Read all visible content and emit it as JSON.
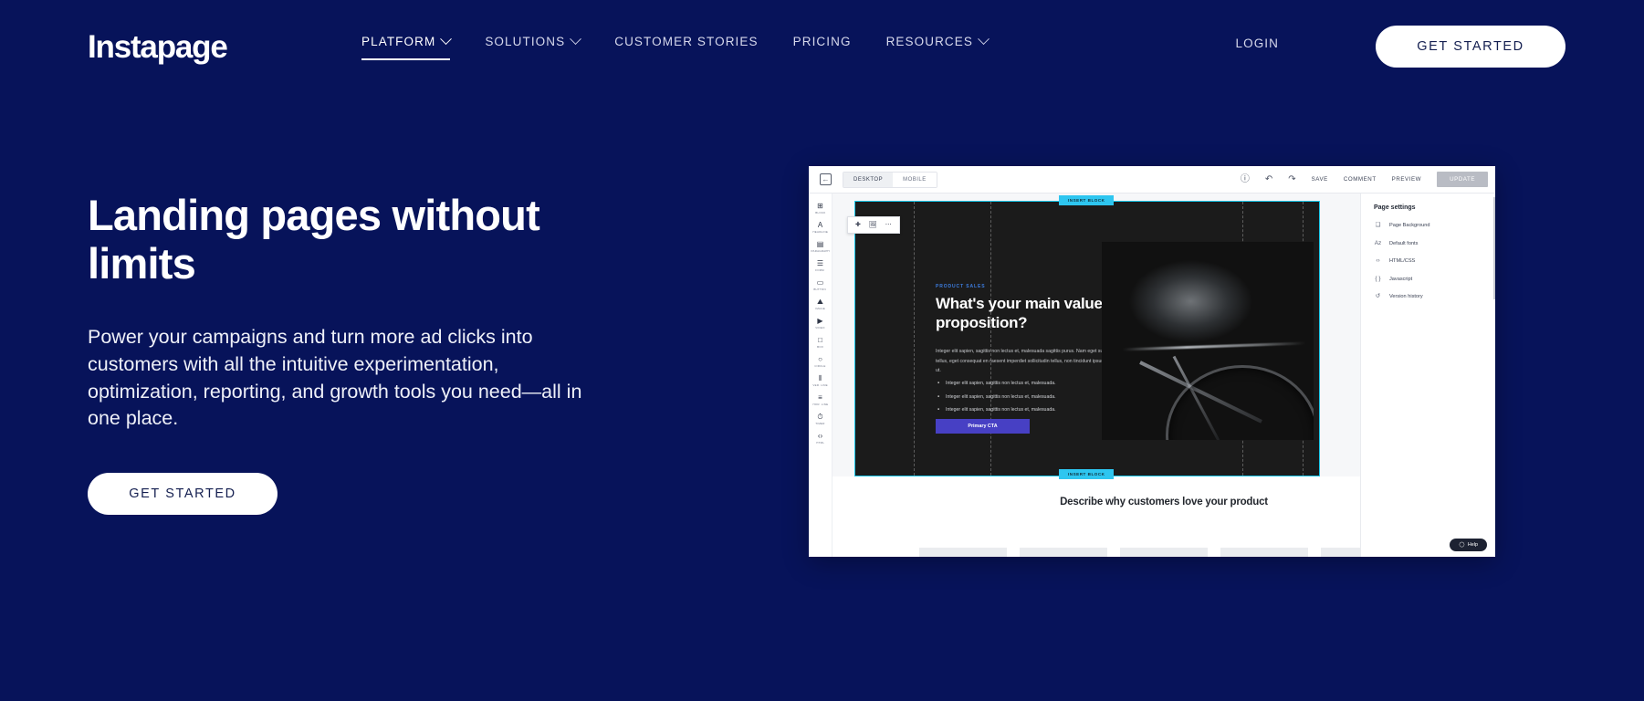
{
  "brand": {
    "logo_text": "Instapage",
    "bg_color": "#07135a",
    "accent_white": "#ffffff"
  },
  "nav": {
    "items": [
      {
        "label": "PLATFORM",
        "has_dropdown": true,
        "active": true
      },
      {
        "label": "SOLUTIONS",
        "has_dropdown": true,
        "active": false
      },
      {
        "label": "CUSTOMER STORIES",
        "has_dropdown": false,
        "active": false
      },
      {
        "label": "PRICING",
        "has_dropdown": false,
        "active": false
      },
      {
        "label": "RESOURCES",
        "has_dropdown": true,
        "active": false
      }
    ],
    "login_label": "LOGIN",
    "cta_label": "GET STARTED"
  },
  "hero": {
    "title": "Landing pages without limits",
    "subtitle": "Power your campaigns and turn more ad clicks into customers with all the intuitive experimentation, optimization, reporting, and growth tools you need—all in one place.",
    "cta_label": "GET STARTED"
  },
  "editor": {
    "topbar": {
      "collapse_icon": "collapse-panel-icon",
      "viewport_tabs": [
        {
          "label": "DESKTOP",
          "active": true
        },
        {
          "label": "MOBILE",
          "active": false
        }
      ],
      "help_icon": "question-circle-icon",
      "undo_icon": "undo-arrow-icon",
      "redo_icon": "redo-arrow-icon",
      "save_label": "SAVE",
      "comment_label": "COMMENT",
      "preview_label": "PREVIEW",
      "update_label": "UPDATE"
    },
    "rail": [
      {
        "label": "BLOCK",
        "glyph": "⊞"
      },
      {
        "label": "HEADLINE",
        "glyph": "A"
      },
      {
        "label": "PARAGRAPH",
        "glyph": "▤"
      },
      {
        "label": "FORM",
        "glyph": "☰"
      },
      {
        "label": "BUTTON",
        "glyph": "▭"
      },
      {
        "label": "IMAGE",
        "glyph": "⛰"
      },
      {
        "label": "VIDEO",
        "glyph": "▶"
      },
      {
        "label": "BOX",
        "glyph": "□"
      },
      {
        "label": "CIRCLE",
        "glyph": "○"
      },
      {
        "label": "VER. LINE",
        "glyph": "⫴"
      },
      {
        "label": "HOR. LINE",
        "glyph": "≡"
      },
      {
        "label": "TIMER",
        "glyph": "⏱"
      },
      {
        "label": "HTML",
        "glyph": "‹›"
      }
    ],
    "canvas": {
      "insert_block_top_label": "INSERT BLOCK",
      "insert_block_bottom_label": "INSERT BLOCK",
      "mini_toolbar": [
        {
          "name": "add-icon",
          "glyph": "✚"
        },
        {
          "name": "image-icon",
          "glyph": "ὛC"
        },
        {
          "name": "more-options-icon",
          "glyph": "⋯"
        }
      ],
      "eyebrow": "PRODUCT SALES",
      "heading": "What's your main value proposition?",
      "paragraph": "Integer elit sapien, sagittis non lectus et, malesuada sagittis purus. Nam eget suscipit tellus, eget consequat en raesent imperdiet sollicitudin tellus, non tincidunt ipsum gravida ut.",
      "bullets": [
        "Integer elit sapien, sagittis non lectus et, malesuada.",
        "Integer elit sapien, sagittis non lectus et, malesuada.",
        "Integer elit sapien, sagittis non lectus et, malesuada."
      ],
      "cta_label": "Primary CTA",
      "cta_color": "#4740c4",
      "image_alt": "cyclist-hands-on-handlebars-photo",
      "bottom_section_title": "Describe why customers love your product"
    },
    "right_panel": {
      "title": "Page settings",
      "items": [
        {
          "label": "Page Background",
          "icon": "image-frame-icon",
          "glyph": "❑"
        },
        {
          "label": "Default fonts",
          "icon": "font-icon",
          "glyph": "Az"
        },
        {
          "label": "HTML/CSS",
          "icon": "code-brackets-icon",
          "glyph": "‹›"
        },
        {
          "label": "Javascript",
          "icon": "curly-braces-icon",
          "glyph": "{ }"
        },
        {
          "label": "Version history",
          "icon": "history-clock-icon",
          "glyph": "↺"
        }
      ]
    },
    "help_widget": {
      "label": "Help",
      "icon": "chat-bubble-icon"
    }
  }
}
